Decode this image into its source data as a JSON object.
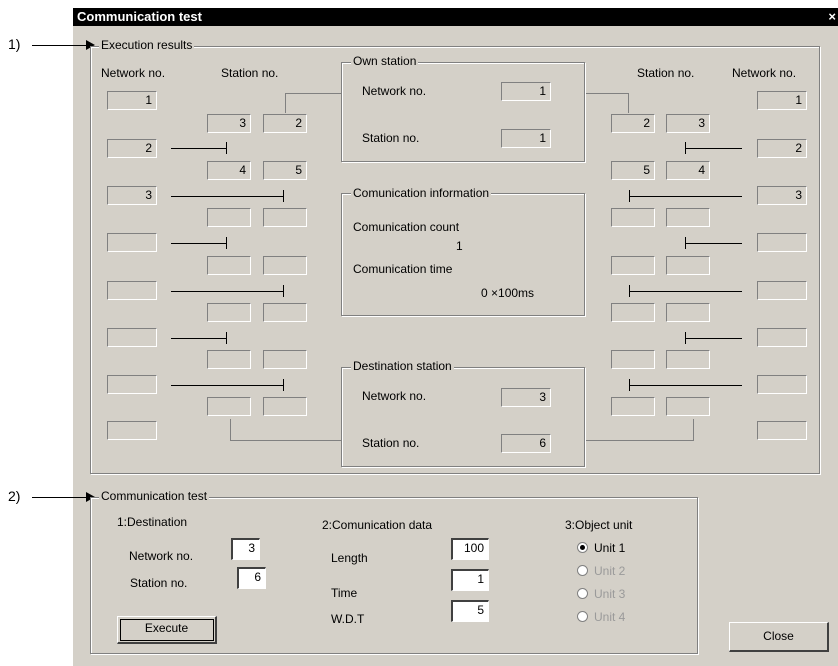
{
  "window": {
    "title": "Communication test",
    "close_glyph": "×"
  },
  "callouts": {
    "c1": "1)",
    "c2": "2)"
  },
  "results": {
    "title": "Execution results",
    "left": {
      "network_header": "Network no.",
      "station_header": "Station no.",
      "networks": [
        "1",
        "2",
        "3",
        "",
        "",
        "",
        "",
        ""
      ],
      "stations": [
        [
          "3",
          "2"
        ],
        [
          "4",
          "5"
        ],
        [
          "",
          ""
        ],
        [
          "",
          ""
        ],
        [
          "",
          ""
        ],
        [
          "",
          ""
        ],
        [
          "",
          ""
        ]
      ]
    },
    "right": {
      "network_header": "Network no.",
      "station_header": "Station no.",
      "networks": [
        "1",
        "2",
        "3",
        "",
        "",
        "",
        "",
        ""
      ],
      "stations": [
        [
          "2",
          "3"
        ],
        [
          "5",
          "4"
        ],
        [
          "",
          ""
        ],
        [
          "",
          ""
        ],
        [
          "",
          ""
        ],
        [
          "",
          ""
        ],
        [
          "",
          ""
        ]
      ]
    },
    "own": {
      "title": "Own station",
      "network_label": "Network no.",
      "network_value": "1",
      "station_label": "Station no.",
      "station_value": "1"
    },
    "info": {
      "title": "Comunication information",
      "count_label": "Comunication count",
      "count_value": "1",
      "time_label": "Comunication time",
      "time_value": "0 ×100ms"
    },
    "dest": {
      "title": "Destination station",
      "network_label": "Network no.",
      "network_value": "3",
      "station_label": "Station no.",
      "station_value": "6"
    }
  },
  "test": {
    "title": "Communication test",
    "destination": {
      "title": "1:Destination",
      "network_label": "Network no.",
      "network_value": "3",
      "station_label": "Station no.",
      "station_value": "6"
    },
    "data": {
      "title": "2:Comunication data",
      "length_label": "Length",
      "length_value": "100",
      "time_label": "Time",
      "time_value": "1",
      "wdt_label": "W.D.T",
      "wdt_value": "5"
    },
    "unit": {
      "title": "3:Object unit",
      "options": [
        {
          "label": "Unit 1",
          "selected": true,
          "enabled": true
        },
        {
          "label": "Unit 2",
          "selected": false,
          "enabled": false
        },
        {
          "label": "Unit 3",
          "selected": false,
          "enabled": false
        },
        {
          "label": "Unit 4",
          "selected": false,
          "enabled": false
        }
      ]
    },
    "execute_label": "Execute"
  },
  "close_label": "Close"
}
